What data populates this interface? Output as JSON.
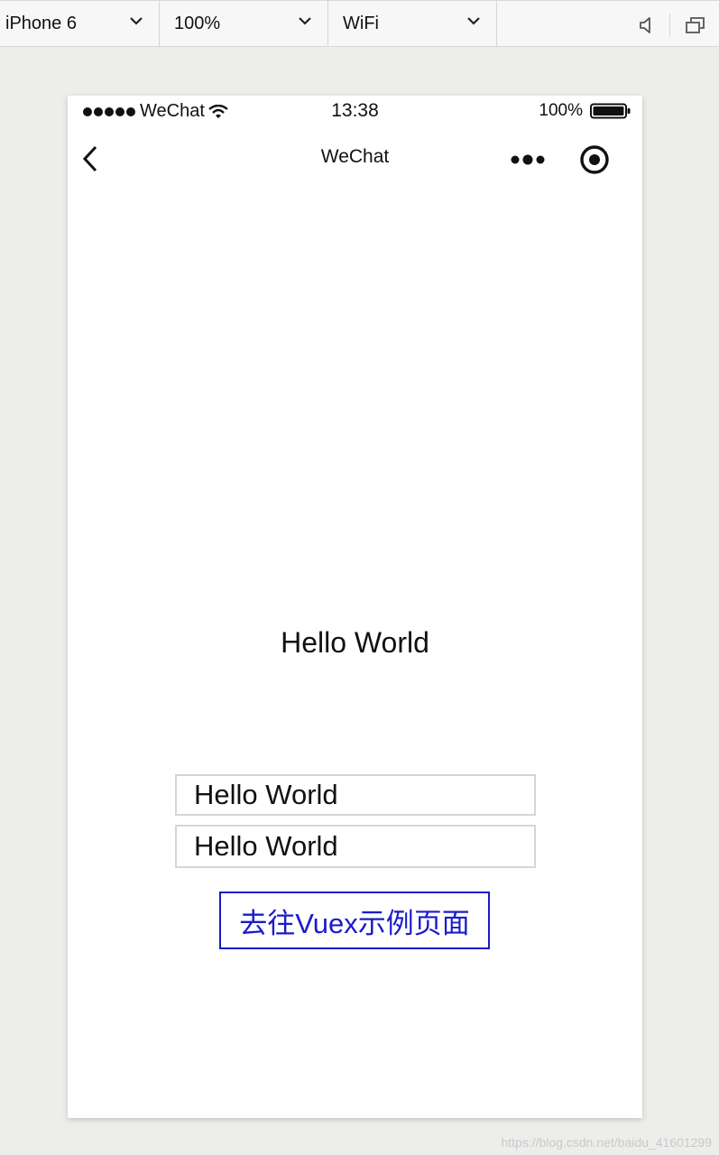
{
  "toolbar": {
    "device": "iPhone 6",
    "zoom": "100%",
    "network": "WiFi"
  },
  "statusbar": {
    "carrier": "WeChat",
    "time": "13:38",
    "battery": "100%"
  },
  "navbar": {
    "title": "WeChat"
  },
  "content": {
    "heading": "Hello World",
    "input1_value": "Hello World",
    "input2_value": "Hello World",
    "button_label": "去往Vuex示例页面"
  },
  "watermark": "https://blog.csdn.net/baidu_41601299",
  "colors": {
    "accent": "#1b1bc8",
    "background": "#ededeb",
    "phone": "#ffffff"
  }
}
